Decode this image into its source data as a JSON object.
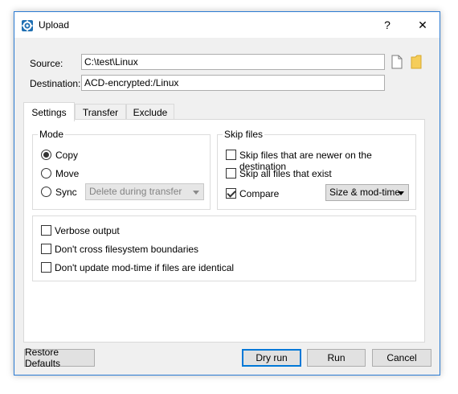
{
  "window": {
    "title": "Upload",
    "help_glyph": "?",
    "close_glyph": "✕",
    "icon": "app-gear-icon"
  },
  "source": {
    "label": "Source:",
    "value": "C:\\test\\Linux"
  },
  "destination": {
    "label": "Destination:",
    "value": "ACD-encrypted:/Linux"
  },
  "source_buttons": {
    "file_icon": "file-icon",
    "folder_icon": "folder-icon"
  },
  "tabs": [
    {
      "label": "Settings",
      "active": true
    },
    {
      "label": "Transfer",
      "active": false
    },
    {
      "label": "Exclude",
      "active": false
    }
  ],
  "mode": {
    "title": "Mode",
    "options": [
      {
        "label": "Copy",
        "checked": true
      },
      {
        "label": "Move",
        "checked": false
      },
      {
        "label": "Sync",
        "checked": false
      }
    ],
    "sync_select": {
      "value": "Delete during transfer",
      "disabled": true
    }
  },
  "skip_files": {
    "title": "Skip files",
    "options": [
      {
        "label": "Skip files that are newer on the destination",
        "checked": false
      },
      {
        "label": "Skip all files that exist",
        "checked": false
      },
      {
        "label": "Compare",
        "checked": true
      }
    ],
    "compare_select": {
      "value": "Size & mod-time"
    }
  },
  "options": [
    {
      "label": "Verbose output",
      "checked": false
    },
    {
      "label": "Don't cross filesystem boundaries",
      "checked": false
    },
    {
      "label": "Don't update mod-time if files are identical",
      "checked": false
    }
  ],
  "buttons": {
    "restore": "Restore Defaults",
    "dry_run": "Dry run",
    "run": "Run",
    "cancel": "Cancel"
  },
  "colors": {
    "accent": "#0078d7",
    "window_border": "#2b7bd3",
    "folder": "#f5cd5a"
  }
}
